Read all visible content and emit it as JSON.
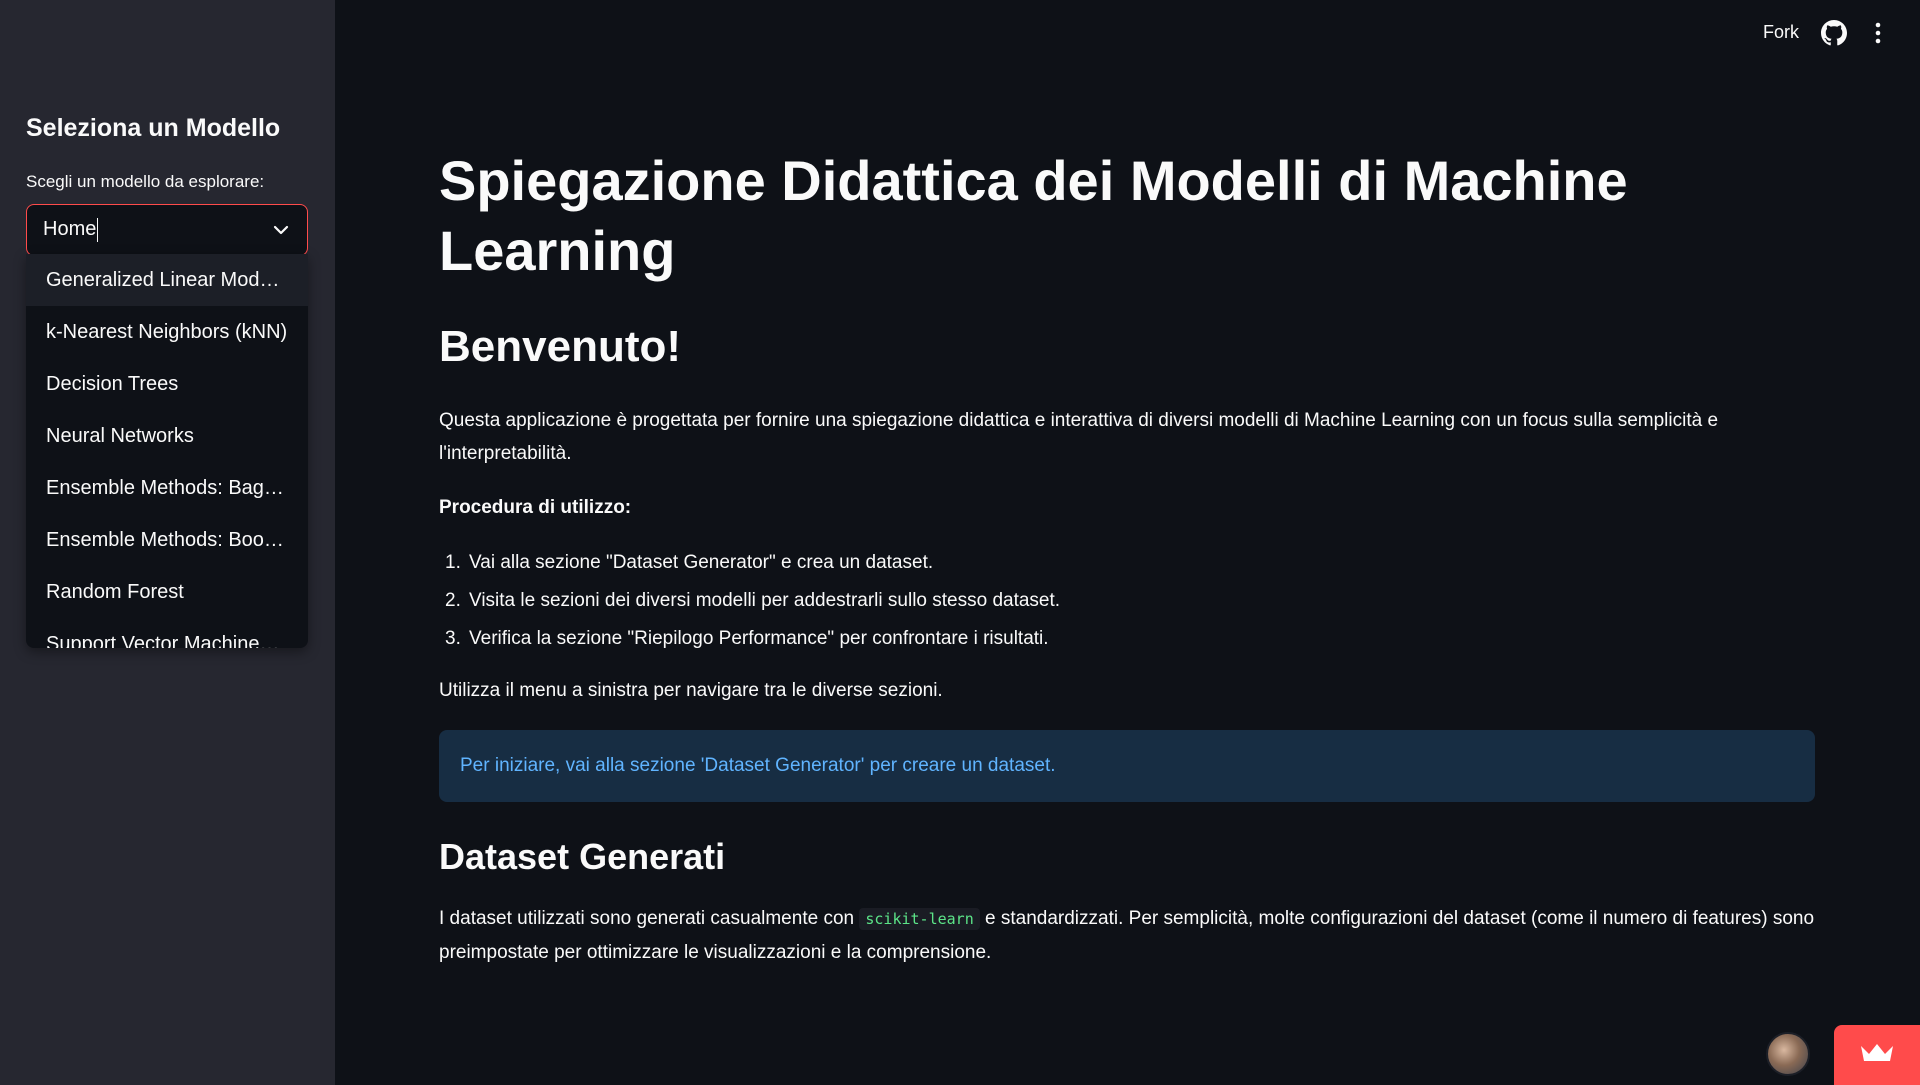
{
  "sidebar": {
    "title": "Seleziona un Modello",
    "select_label": "Scegli un modello da esplorare:",
    "select_value": "Home",
    "options": [
      "Generalized Linear Model…",
      "k-Nearest Neighbors (kNN)",
      "Decision Trees",
      "Neural Networks",
      "Ensemble Methods: Bagg…",
      "Ensemble Methods: Boos…",
      "Random Forest",
      "Support Vector Machines…"
    ]
  },
  "header": {
    "fork_label": "Fork",
    "github_icon": "github-icon",
    "menu_icon": "kebab-menu-icon"
  },
  "main": {
    "title": "Spiegazione Didattica dei Modelli di Machine Learning",
    "welcome_heading": "Benvenuto!",
    "intro": "Questa applicazione è progettata per fornire una spiegazione didattica e interattiva di diversi modelli di Machine Learning con un focus sulla semplicità e l'interpretabilità.",
    "procedure_label": "Procedura di utilizzo:",
    "steps": [
      {
        "num": "1.",
        "text": "Vai alla sezione \"Dataset Generator\" e crea un dataset."
      },
      {
        "num": "2.",
        "text": "Visita le sezioni dei diversi modelli per addestrarli sullo stesso dataset."
      },
      {
        "num": "3.",
        "text": "Verifica la sezione \"Riepilogo Performance\" per confrontare i risultati."
      }
    ],
    "nav_hint": "Utilizza il menu a sinistra per navigare tra le diverse sezioni.",
    "info_message": "Per iniziare, vai alla sezione 'Dataset Generator' per creare un dataset.",
    "dataset_heading": "Dataset Generati",
    "dataset_text_before": "I dataset utilizzati sono generati casualmente con ",
    "dataset_code": "scikit-learn",
    "dataset_text_after": " e standardizzati. Per semplicità, molte configurazioni del dataset (come il numero di features) sono preimpostate per ottimizzare le visualizzazioni e la comprensione."
  },
  "colors": {
    "background": "#0e1117",
    "sidebar": "#262730",
    "accent": "#ff4b4b",
    "info_bg": "#172d43",
    "info_text": "#60b4ff"
  }
}
